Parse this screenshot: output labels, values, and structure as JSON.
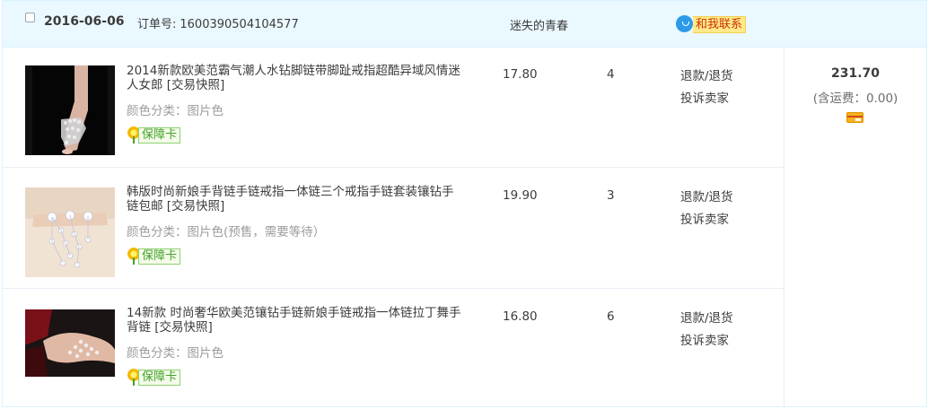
{
  "order": {
    "date": "2016-06-06",
    "order_no_label": "订单号:",
    "order_no": "1600390504104577",
    "shop_name": "迷失的青春",
    "contact_label": "和我联系",
    "total": "231.70",
    "shipping": "(含运费：0.00)"
  },
  "items": [
    {
      "title": "2014新款欧美范霸气潮人水钻脚链带脚趾戒指超酷异域风情迷人女郎 [交易快照]",
      "sku": "颜色分类：图片色",
      "badge": "保障卡",
      "price": "17.80",
      "qty": "4",
      "action1": "退款/退货",
      "action2": "投诉卖家"
    },
    {
      "title": "韩版时尚新娘手背链手链戒指一体链三个戒指手链套装镶钻手链包邮 [交易快照]",
      "sku": "颜色分类：图片色(预售，需要等待）",
      "badge": "保障卡",
      "price": "19.90",
      "qty": "3",
      "action1": "退款/退货",
      "action2": "投诉卖家"
    },
    {
      "title": "14新款 时尚奢华欧美范镶钻手链新娘手链戒指一体链拉丁舞手背链 [交易快照]",
      "sku": "颜色分类：图片色",
      "badge": "保障卡",
      "price": "16.80",
      "qty": "6",
      "action1": "退款/退货",
      "action2": "投诉卖家"
    }
  ],
  "colors": {
    "header_bg": "#eaf8ff",
    "border": "#daf3ff",
    "badge_green": "#44a12b",
    "contact_bg": "#ffe98a"
  },
  "icons": [
    "checkbox-icon",
    "chat-bubble-icon",
    "flower-icon",
    "bank-card-icon"
  ]
}
